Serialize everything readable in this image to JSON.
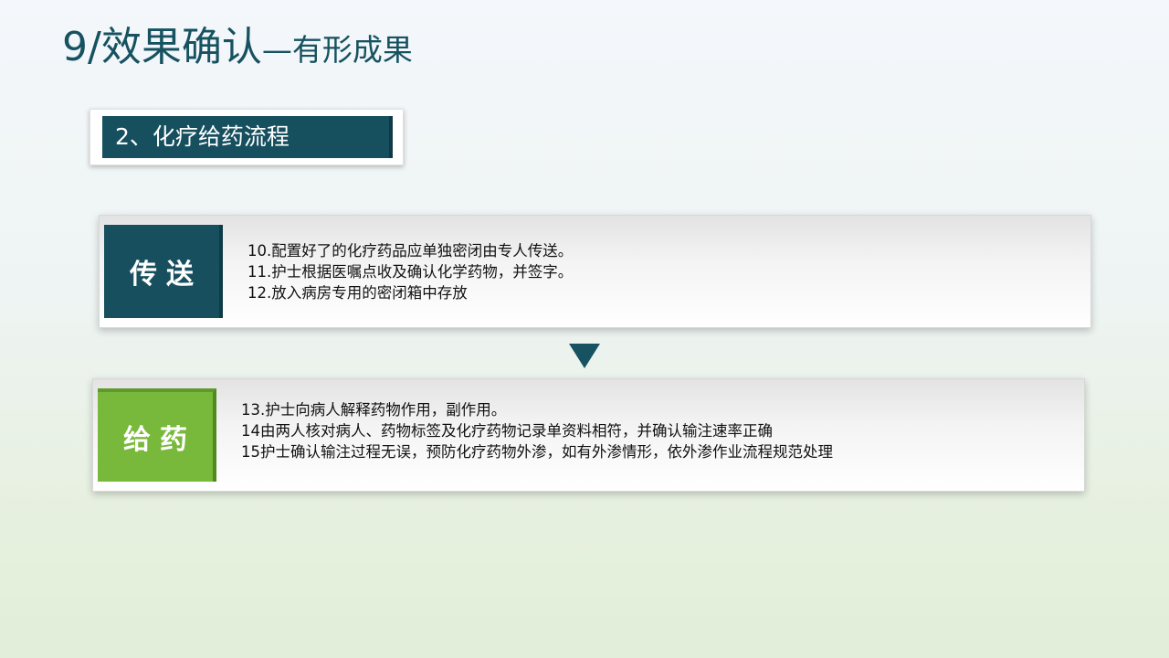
{
  "title": {
    "main": "9/效果确认",
    "sub": "—有形成果"
  },
  "section": {
    "label": "2、化疗给药流程"
  },
  "steps": [
    {
      "tag": "传送",
      "lines": [
        "10.配置好了的化疗药品应单独密闭由专人传送。",
        "11.护士根据医嘱点收及确认化学药物，并签字。",
        "12.放入病房专用的密闭箱中存放"
      ]
    },
    {
      "tag": "给药",
      "lines": [
        "13.护士向病人解释药物作用，副作用。",
        "14由两人核对病人、药物标签及化疗药物记录单资料相符，并确认输注速率正确",
        "15护士确认输注过程无误，预防化疗药物外渗，如有外渗情形，依外渗作业流程规范处理"
      ]
    }
  ],
  "colors": {
    "primary": "#175261",
    "accent_green": "#78b83a"
  },
  "icons": {
    "arrow": "down-triangle-icon"
  }
}
